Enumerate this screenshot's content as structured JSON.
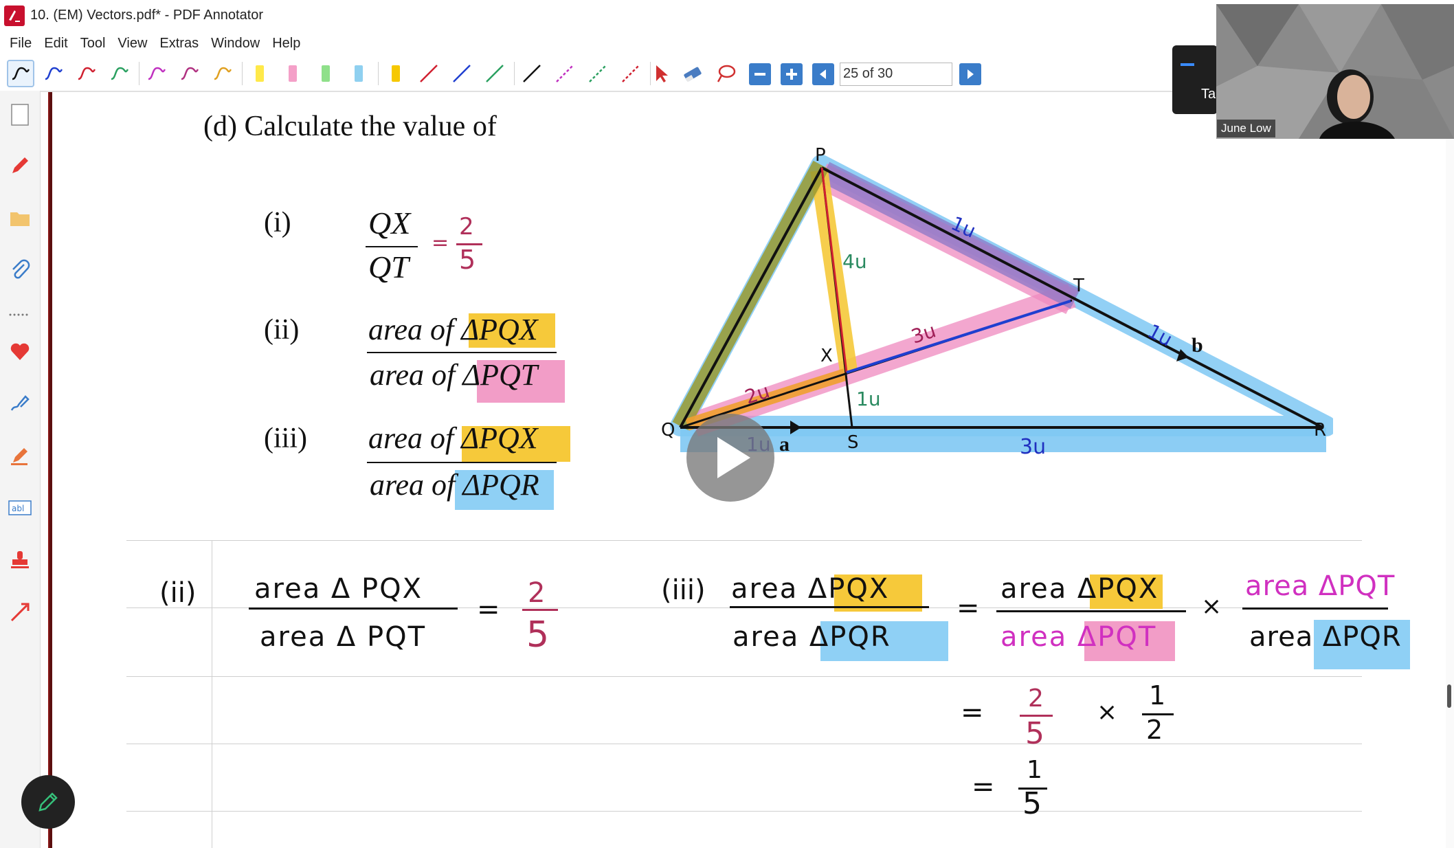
{
  "window": {
    "title": "10. (EM) Vectors.pdf* - PDF Annotator"
  },
  "menu": [
    "File",
    "Edit",
    "Tool",
    "View",
    "Extras",
    "Window",
    "Help"
  ],
  "toolbar": {
    "page_indicator": "25 of 30",
    "pen_colors": [
      "#111111",
      "#1f3fd0",
      "#d02030",
      "#2aa060",
      "#c030c0",
      "#b03080",
      "#e0a020"
    ],
    "highlighter_colors": [
      "#ffe94a",
      "#f4a0c8",
      "#8fe08a",
      "#8fd0f0",
      "#f6c800"
    ],
    "line_colors": [
      "#d02030",
      "#1f3fd0",
      "#2aa060",
      "#111111",
      "#c030c0",
      "#2aa060",
      "#d02030"
    ]
  },
  "question": {
    "heading": "(d) Calculate the value of",
    "parts": [
      {
        "label": "(i)",
        "numerator": "QX",
        "denominator": "QT",
        "answer_num": "2",
        "answer_den": "5",
        "eq": "="
      },
      {
        "label": "(ii)",
        "numerator": "area of ΔPQX",
        "denominator": "area of ΔPQT"
      },
      {
        "label": "(iii)",
        "numerator": "area of ΔPQX",
        "denominator": "area of ΔPQR"
      }
    ]
  },
  "diagram": {
    "points": {
      "P": "P",
      "Q": "Q",
      "R": "R",
      "S": "S",
      "T": "T",
      "X": "X"
    },
    "labels": {
      "pt_u1": "1u",
      "px_u": "4u",
      "xt_u": "3u",
      "qx_u": "2u",
      "xs_u": "1u",
      "tr_u": "1u",
      "qs_u": "1u",
      "sr_u": "3u",
      "vec_a": "a",
      "vec_b": "b"
    }
  },
  "working": {
    "ii": {
      "label": "(ii)",
      "num": "area Δ PQX",
      "den": "area Δ PQT",
      "eq": "=",
      "ans_num": "2",
      "ans_den": "5"
    },
    "iii": {
      "label": "(iii)",
      "lhs_num": "area ΔPQX",
      "lhs_den": "area ΔPQR",
      "eq": "=",
      "f1_num": "area ΔPQX",
      "f1_den": "area ΔPQT",
      "times": "×",
      "f2_num": "area ΔPQT",
      "f2_den": "area ΔPQR",
      "step2_eq": "=",
      "step2_a_num": "2",
      "step2_a_den": "5",
      "step2_times": "×",
      "step2_b_num": "1",
      "step2_b_den": "2",
      "step3_eq": "=",
      "step3_num": "1",
      "step3_den": "5"
    }
  },
  "webcam": {
    "name": "June Low",
    "panel_text": "Ta"
  }
}
